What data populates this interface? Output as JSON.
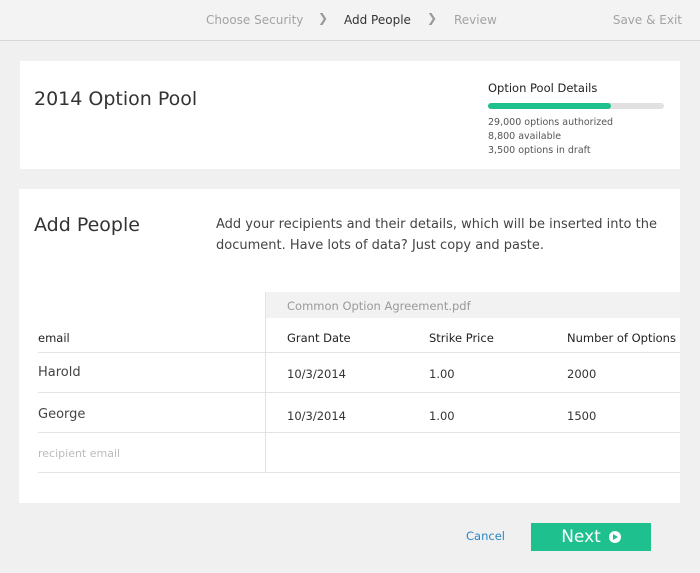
{
  "nav": {
    "steps": [
      "Choose Security",
      "Add People",
      "Review"
    ],
    "active_step": "Add People",
    "save_exit": "Save & Exit"
  },
  "pool": {
    "title": "2014 Option Pool",
    "details_title": "Option Pool Details",
    "progress_fraction": 0.7,
    "authorized": "29,000 options authorized",
    "available": "8,800 available",
    "draft": "3,500 options in draft",
    "progress_color": "#1ec08e"
  },
  "people": {
    "title": "Add People",
    "description": "Add your recipients and their details, which will be inserted into the document. Have lots of data? Just copy and paste.",
    "document_name": "Common Option Agreement.pdf",
    "columns": {
      "email": "email",
      "grant_date": "Grant Date",
      "strike_price": "Strike Price",
      "num_options": "Number of Options"
    },
    "rows": [
      {
        "email": "Harold",
        "grant_date": "10/3/2014",
        "strike_price": "1.00",
        "num_options": "2000"
      },
      {
        "email": "George",
        "grant_date": "10/3/2014",
        "strike_price": "1.00",
        "num_options": "1500"
      }
    ],
    "new_row_placeholder": "recipient email"
  },
  "footer": {
    "cancel": "Cancel",
    "next": "Next",
    "accent": "#1ec08e",
    "link_color": "#2b86c6"
  },
  "icons": {
    "step_separator": "chevron-right-icon",
    "next": "arrow-circle-right-icon"
  }
}
